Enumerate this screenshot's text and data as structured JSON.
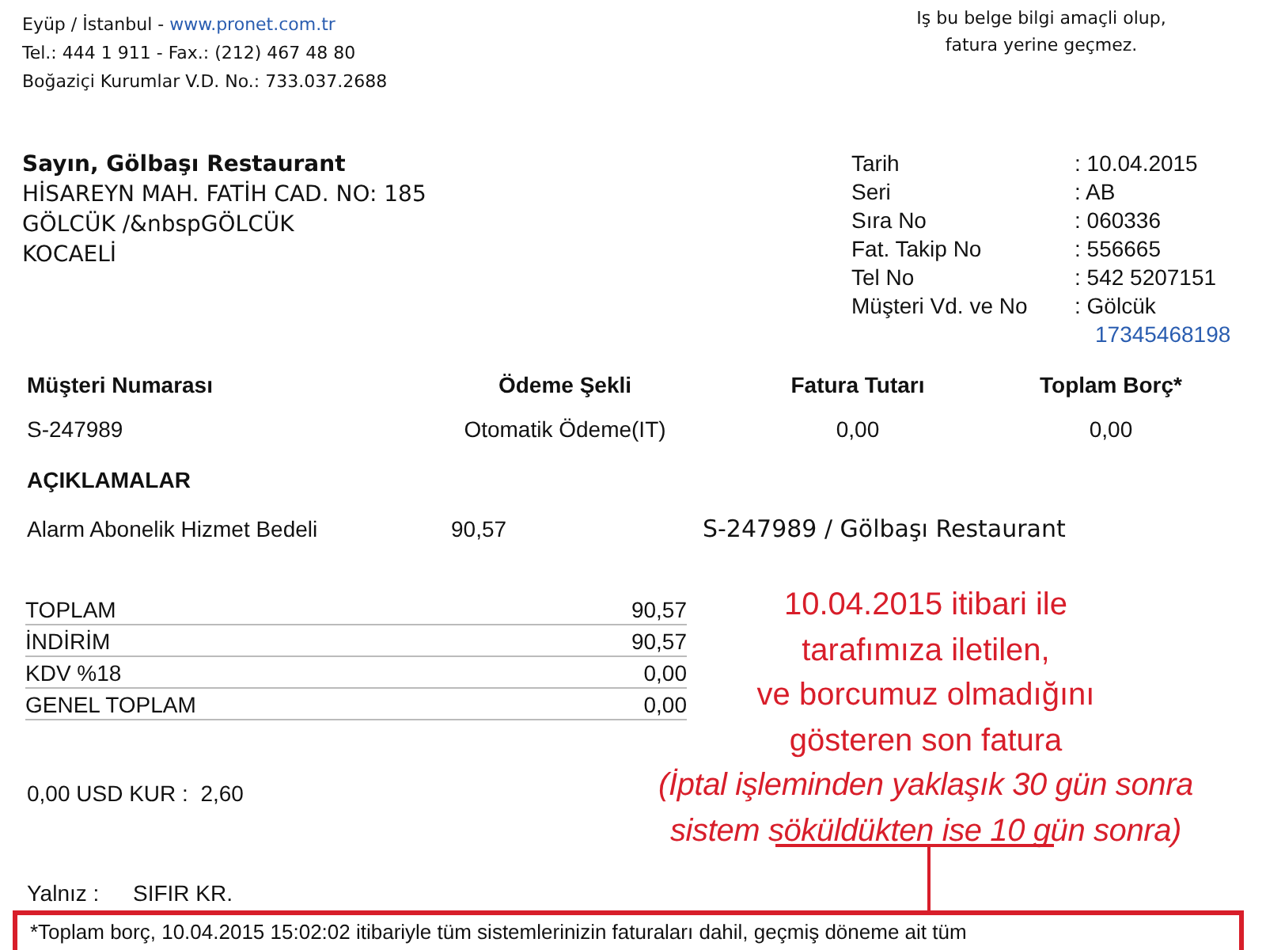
{
  "company": {
    "address_line": "Eyüp / İstanbul - ",
    "website": "www.pronet.com.tr",
    "phone_fax": "Tel.: 444 1 911 - Fax.: (212) 467 48 80",
    "tax_office": "Boğaziçi Kurumlar V.D. No.: 733.037.2688"
  },
  "notice": [
    "Iş bu belge bilgi amaçli olup,",
    "fatura yerine geçmez."
  ],
  "customer": {
    "greeting": "Sayın, Gölbaşı Restaurant",
    "address": [
      "HİSAREYN MAH. FATİH CAD. NO: 185",
      "GÖLCÜK /&nbspGÖLCÜK",
      "KOCAELİ"
    ]
  },
  "invoice_info": [
    {
      "label": "Tarih",
      "value": ": 10.04.2015"
    },
    {
      "label": "Seri",
      "value": ": AB"
    },
    {
      "label": "Sıra No",
      "value": ": 060336"
    },
    {
      "label": "Fat. Takip No",
      "value": ": 556665"
    },
    {
      "label": "Tel No",
      "value": ": 542 5207151"
    },
    {
      "label": "Müşteri Vd. ve No",
      "value": ": Gölcük",
      "extra": "17345468198"
    }
  ],
  "summary": {
    "columns": [
      "Müşteri Numarası",
      "Ödeme Şekli",
      "Fatura Tutarı",
      "Toplam Borç*"
    ],
    "row": [
      "S-247989",
      "Otomatik Ödeme(IT)",
      "0,00",
      "0,00"
    ]
  },
  "descriptions": {
    "heading": "AÇIKLAMALAR",
    "items": [
      {
        "name": "Alarm Abonelik Hizmet Bedeli",
        "amount": "90,57",
        "reference": "S-247989 / Gölbaşı Restaurant"
      }
    ]
  },
  "totals": [
    {
      "label": "TOPLAM",
      "value": "90,57"
    },
    {
      "label": "İNDİRİM",
      "value": "90,57"
    },
    {
      "label": "KDV %18",
      "value": "0,00"
    },
    {
      "label": "GENEL TOPLAM",
      "value": "0,00"
    }
  ],
  "exchange": "0,00 USD KUR :  2,60",
  "in_words": {
    "label": "Yalnız :",
    "value": "SIFIR KR."
  },
  "footnote": "*Toplam borç, 10.04.2015 15:02:02 itibariyle tüm sistemlerinizin faturaları dahil, geçmiş döneme ait tüm",
  "annotation": {
    "lines": [
      "10.04.2015 itibari ile",
      "tarafımıza iletilen,",
      "ve borcumuz olmadığını",
      "gösteren son fatura"
    ],
    "note_lines": [
      "(İptal işleminden yaklaşık 30 gün sonra",
      "sistem söküldükten ise 10 gün sonra)"
    ]
  }
}
